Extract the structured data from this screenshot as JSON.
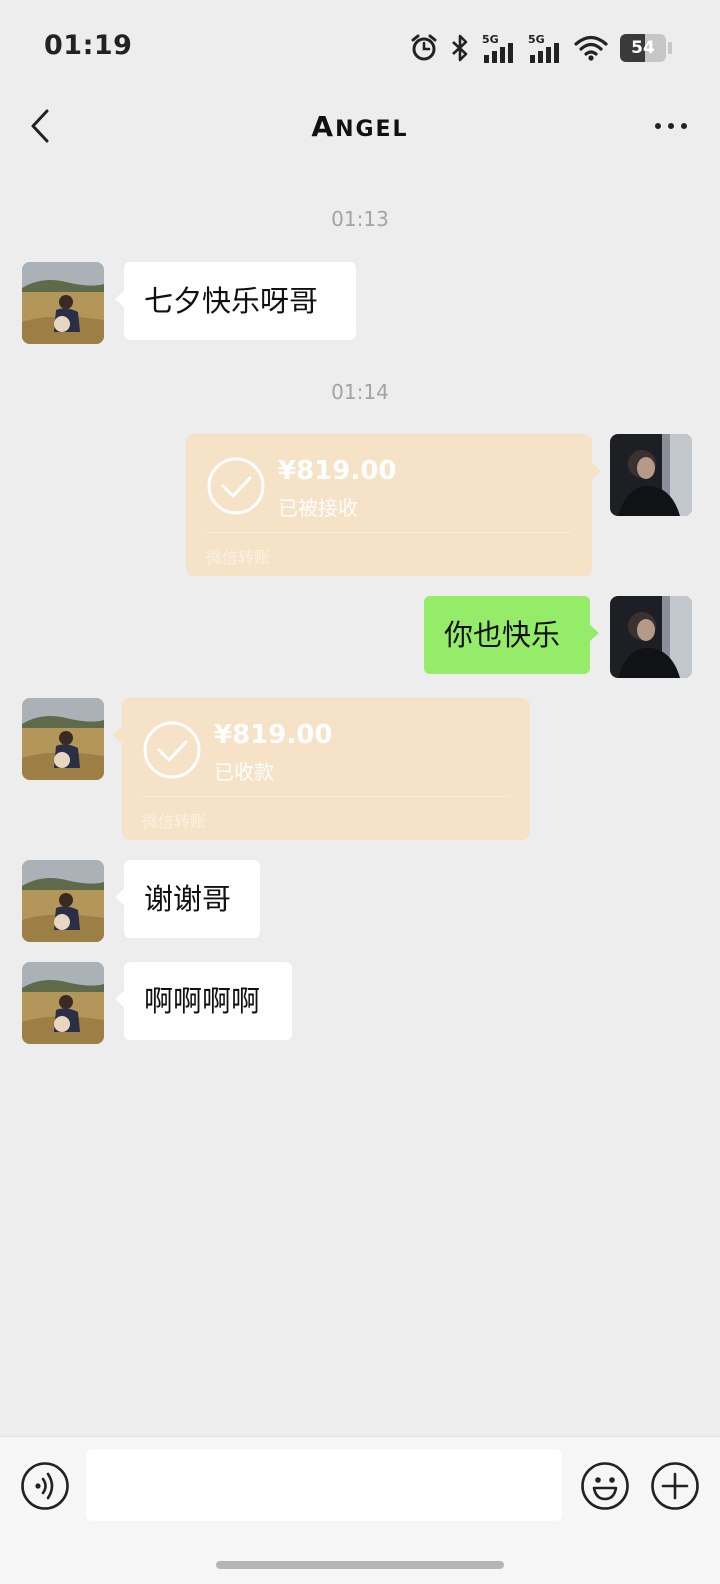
{
  "status_bar": {
    "time": "01:19",
    "network_1": "5G",
    "network_2": "5G",
    "battery_percent": 54,
    "battery_text": "54",
    "icons": [
      "alarm-icon",
      "bluetooth-icon",
      "signal-5g-icon",
      "signal-5g-icon",
      "wifi-icon",
      "battery-icon"
    ]
  },
  "nav": {
    "title_initial": "A",
    "title_rest": "NGEL",
    "back_icon": "chevron-left-icon",
    "more_icon": "more-dots-icon"
  },
  "chat": {
    "timestamps": [
      "01:13",
      "01:14"
    ],
    "messages": [
      {
        "side": "left",
        "type": "text",
        "text": "七夕快乐呀哥"
      },
      {
        "side": "right",
        "type": "transfer",
        "amount": "¥819.00",
        "status": "已被接收",
        "label": "微信转账"
      },
      {
        "side": "right",
        "type": "text",
        "text": "你也快乐"
      },
      {
        "side": "left",
        "type": "transfer",
        "amount": "¥819.00",
        "status": "已收款",
        "label": "微信转账"
      },
      {
        "side": "left",
        "type": "text",
        "text": "谢谢哥"
      },
      {
        "side": "left",
        "type": "text",
        "text": "啊啊啊啊"
      }
    ]
  },
  "input_bar": {
    "placeholder": "",
    "value": "",
    "icons": [
      "voice-icon",
      "emoji-icon",
      "plus-icon"
    ]
  },
  "colors": {
    "background": "#ededed",
    "sent_bubble": "#95ec69",
    "received_bubble": "#ffffff",
    "transfer_card": "#f6e2c6"
  }
}
